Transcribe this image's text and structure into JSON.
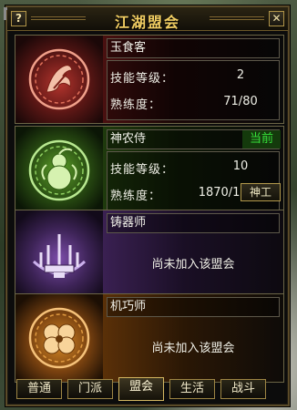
{
  "window": {
    "title": "江湖盟会",
    "help_label": "?",
    "close_label": "✕"
  },
  "guilds": [
    {
      "name": "玉食客",
      "level_label": "技能等级：",
      "level": "2",
      "prof_label": "熟练度：",
      "proficiency": "71/80",
      "theme": "#b4342d",
      "emblem": "phoenix-emblem-icon"
    },
    {
      "name": "神农侍",
      "status": "当前",
      "level_label": "技能等级：",
      "level": "10",
      "prof_label": "熟练度：",
      "proficiency": "1870/1870",
      "action_label": "神工",
      "theme": "#5ea22a",
      "emblem": "gourd-emblem-icon"
    },
    {
      "name": "铸器师",
      "not_joined": "尚未加入该盟会",
      "theme": "#7b4ca8",
      "emblem": "anvil-emblem-icon"
    },
    {
      "name": "机巧师",
      "not_joined": "尚未加入该盟会",
      "theme": "#d88a26",
      "emblem": "gear-emblem-icon"
    }
  ],
  "tabs": [
    {
      "label": "普通"
    },
    {
      "label": "门派"
    },
    {
      "label": "盟会",
      "active": true
    },
    {
      "label": "生活"
    },
    {
      "label": "战斗"
    }
  ],
  "colors": {
    "title": "#f3cf63",
    "current": "#36e23a",
    "frame": "#5a4a28"
  }
}
